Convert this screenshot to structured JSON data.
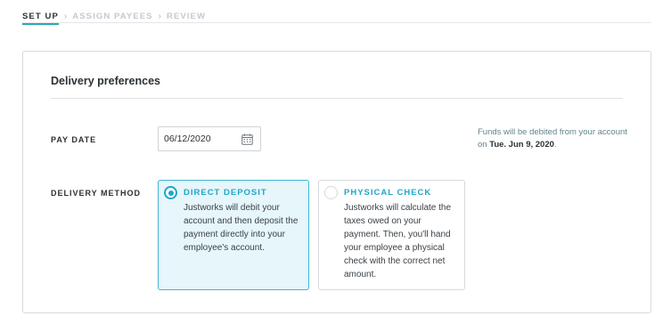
{
  "stepper": {
    "steps": [
      {
        "label": "SET UP",
        "active": true
      },
      {
        "label": "ASSIGN PAYEES",
        "active": false
      },
      {
        "label": "REVIEW",
        "active": false
      }
    ],
    "separator": ">"
  },
  "card": {
    "title": "Delivery preferences",
    "pay_date": {
      "label": "PAY DATE",
      "value": "06/12/2020",
      "icon": "calendar-icon"
    },
    "funds_note": {
      "text": "Funds will be debited from your account on",
      "date": "Tue. Jun 9, 2020",
      "suffix": "."
    },
    "delivery_method": {
      "label": "DELIVERY METHOD",
      "options": [
        {
          "title": "DIRECT DEPOSIT",
          "description": "Justworks will debit your account and then deposit the payment directly into your employee's account.",
          "selected": true
        },
        {
          "title": "PHYSICAL CHECK",
          "description": "Justworks will calculate the taxes owed on your payment. Then, you'll hand your employee a physical check with the correct net amount.",
          "selected": false
        }
      ]
    }
  },
  "colors": {
    "accent": "#1fa7c9",
    "selected_bg": "#e6f6fa",
    "note_text": "#62838f"
  }
}
